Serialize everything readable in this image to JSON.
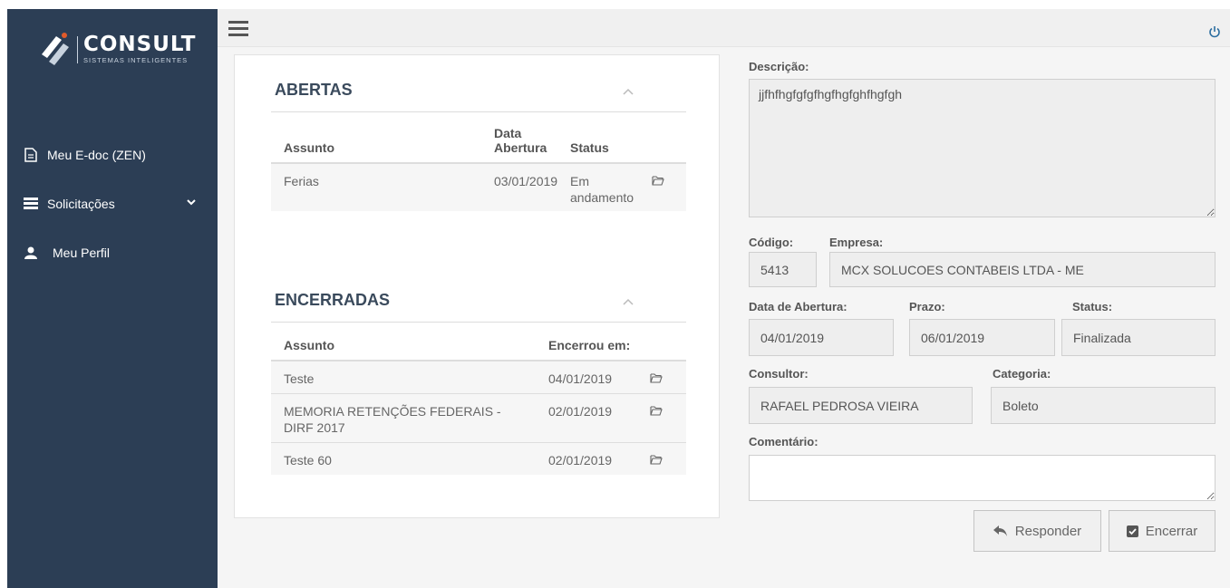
{
  "brand": {
    "name": "CONSULT",
    "tagline": "SISTEMAS INTELIGENTES"
  },
  "sidebar": {
    "items": [
      {
        "label": "Meu E-doc (ZEN)",
        "icon": "document-icon"
      },
      {
        "label": "Solicitações",
        "icon": "list-icon"
      },
      {
        "label": "Meu Perfil",
        "icon": "user-icon"
      }
    ]
  },
  "abertas": {
    "title": "ABERTAS",
    "columns": [
      "Assunto",
      "Data Abertura",
      "Status"
    ],
    "rows": [
      {
        "assunto": "Ferias",
        "data": "03/01/2019",
        "status": "Em andamento"
      }
    ]
  },
  "encerradas": {
    "title": "ENCERRADAS",
    "columns": [
      "Assunto",
      "Encerrou em:"
    ],
    "rows": [
      {
        "assunto": "Teste",
        "data": "04/01/2019"
      },
      {
        "assunto": "MEMORIA RETENÇÕES FEDERAIS - DIRF 2017",
        "data": "02/01/2019"
      },
      {
        "assunto": "Teste 60",
        "data": "02/01/2019"
      }
    ]
  },
  "form": {
    "descricao_label": "Descrição:",
    "descricao": "jjfhfhgfgfgfhgfhgfghfhgfgh",
    "codigo_label": "Código:",
    "codigo": "5413",
    "empresa_label": "Empresa:",
    "empresa": "MCX SOLUCOES CONTABEIS LTDA - ME",
    "data_abertura_label": "Data de Abertura:",
    "data_abertura": "04/01/2019",
    "prazo_label": "Prazo:",
    "prazo": "06/01/2019",
    "status_label": "Status:",
    "status": "Finalizada",
    "consultor_label": "Consultor:",
    "consultor": "RAFAEL PEDROSA VIEIRA",
    "categoria_label": "Categoria:",
    "categoria": "Boleto",
    "comentario_label": "Comentário:",
    "comentario": ""
  },
  "buttons": {
    "responder": "Responder",
    "encerrar": "Encerrar"
  },
  "colors": {
    "sidebar": "#2c3e55",
    "accent": "#2c3e55"
  }
}
